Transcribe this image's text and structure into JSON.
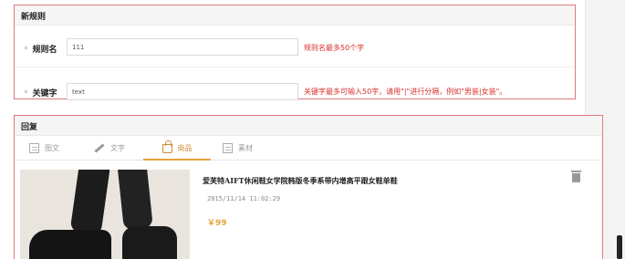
{
  "rule_section": {
    "title": "新规则",
    "rule_name": {
      "label": "规则名",
      "required_mark": "*",
      "value": "111",
      "hint": "规则名最多50个字"
    },
    "keyword": {
      "label": "关键字",
      "required_mark": "*",
      "value": "text",
      "hint": "关键字最多可输入50字，请用\"|\"进行分隔，例如\"男装|女装\"。"
    }
  },
  "reply_section": {
    "title": "回复",
    "tabs": [
      {
        "label": "图文",
        "icon": "image-text-icon",
        "active": false
      },
      {
        "label": "文字",
        "icon": "pen-icon",
        "active": false
      },
      {
        "label": "商品",
        "icon": "shopping-bag-icon",
        "active": true
      },
      {
        "label": "素材",
        "icon": "material-icon",
        "active": false
      }
    ],
    "product": {
      "title": "爱芙特AIFT休闲鞋女学院韩版冬季系带内增高平跟女鞋单鞋",
      "time": "2015/11/14 11:02:29",
      "price": "￥99",
      "delete_icon": "trash-icon"
    }
  },
  "colors": {
    "accent": "#e6a23c",
    "hint_red": "#d9302b",
    "highlight_border": "#e07a7a"
  }
}
